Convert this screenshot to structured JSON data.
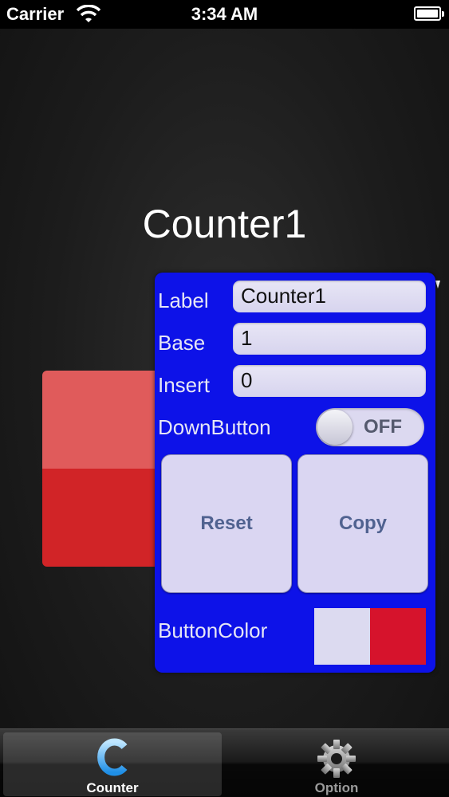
{
  "status_bar": {
    "carrier": "Carrier",
    "time": "3:34 AM"
  },
  "counter": {
    "title": "Counter1"
  },
  "options": {
    "label": {
      "label": "Label",
      "value": "Counter1"
    },
    "base": {
      "label": "Base",
      "value": "1"
    },
    "insert": {
      "label": "Insert",
      "value": "0"
    },
    "down_button": {
      "label": "DownButton",
      "state": "OFF"
    },
    "reset_label": "Reset",
    "copy_label": "Copy",
    "button_color": {
      "label": "ButtonColor",
      "colors": [
        "#dcdaf0",
        "#d6132c"
      ]
    }
  },
  "colors": {
    "popover": "#0d12e8",
    "counter_up": "#e05b5b",
    "counter_down": "#d12427"
  },
  "tab_bar": {
    "tabs": [
      {
        "label": "Counter",
        "icon": "counter-c-icon",
        "selected": true
      },
      {
        "label": "Option",
        "icon": "gear-icon",
        "selected": false
      }
    ]
  }
}
